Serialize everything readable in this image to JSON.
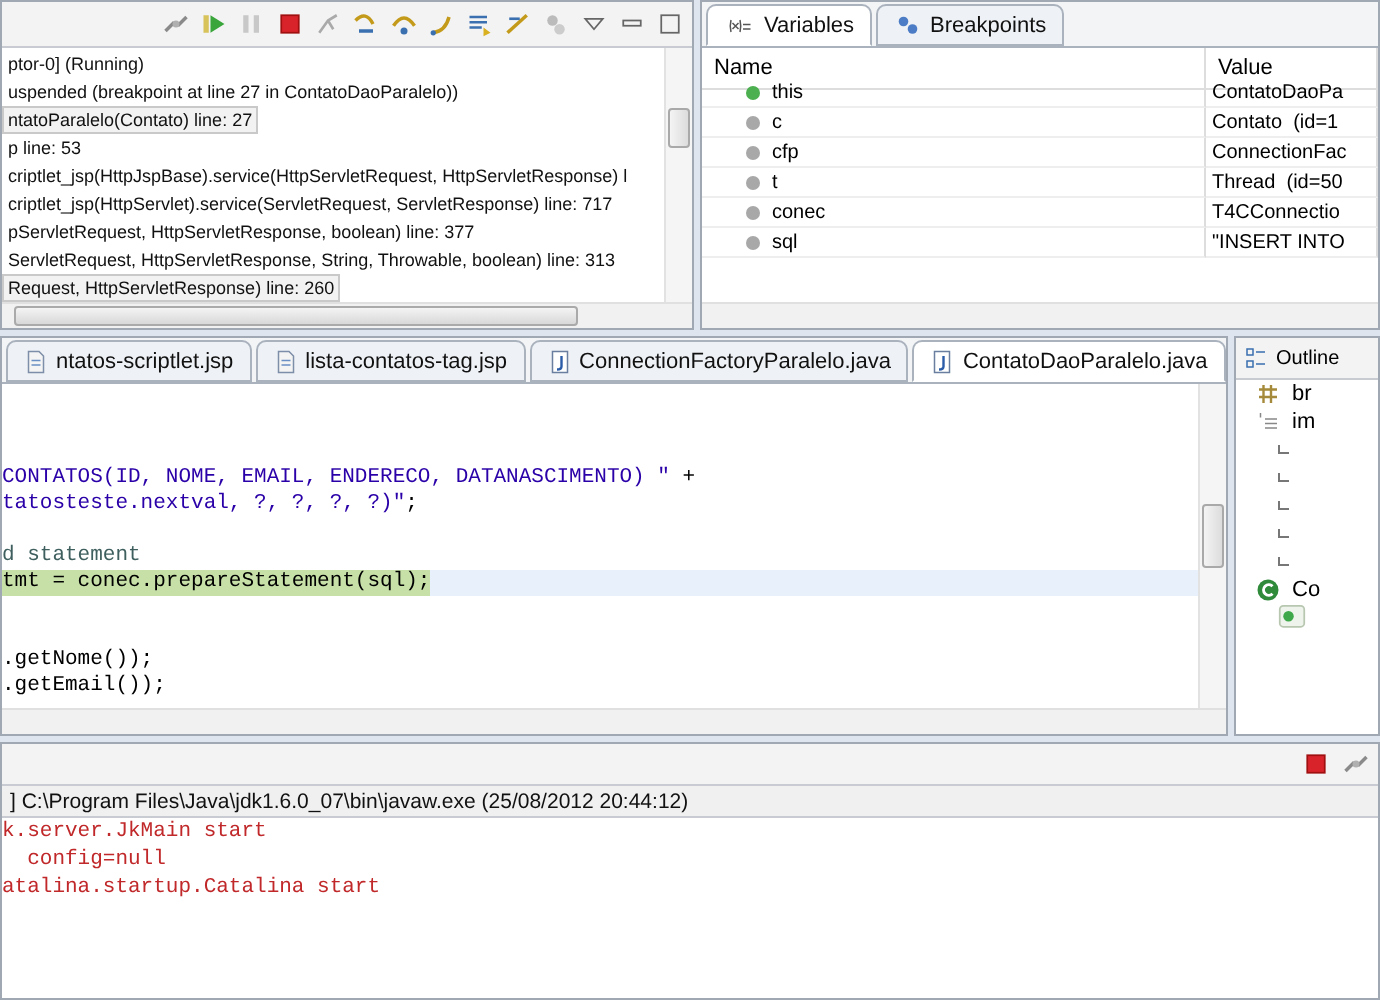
{
  "debug": {
    "frames": [
      {
        "text": "ptor-0] (Running)",
        "selected": false
      },
      {
        "text": "uspended (breakpoint at line 27 in ContatoDaoParalelo))",
        "selected": false
      },
      {
        "text": "ntatoParalelo(Contato) line: 27",
        "selected": true
      },
      {
        "text": "p line: 53",
        "selected": false
      },
      {
        "text": "criptlet_jsp(HttpJspBase).service(HttpServletRequest, HttpServletResponse) l",
        "selected": false
      },
      {
        "text": "criptlet_jsp(HttpServlet).service(ServletRequest, ServletResponse) line: 717",
        "selected": false
      },
      {
        "text": "pServletRequest, HttpServletResponse, boolean) line: 377",
        "selected": false
      },
      {
        "text": "ServletRequest, HttpServletResponse, String, Throwable, boolean) line: 313",
        "selected": false
      },
      {
        "text": "Request, HttpServletResponse) line: 260",
        "selected": true
      }
    ]
  },
  "variables": {
    "tabs": [
      {
        "label": "Variables",
        "kind": "variables",
        "selected": true
      },
      {
        "label": "Breakpoints",
        "kind": "breakpoints",
        "selected": false
      }
    ],
    "columns": [
      "Name",
      "Value"
    ],
    "rows": [
      {
        "name": "this",
        "value": "ContatoDaoPa",
        "color": "#4caf50"
      },
      {
        "name": "c",
        "value": "Contato  (id=1",
        "color": "#a8a8a8"
      },
      {
        "name": "cfp",
        "value": "ConnectionFac",
        "color": "#a8a8a8"
      },
      {
        "name": "t",
        "value": "Thread  (id=50",
        "color": "#a8a8a8"
      },
      {
        "name": "conec",
        "value": "T4CConnectio",
        "color": "#a8a8a8"
      },
      {
        "name": "sql",
        "value": "\"INSERT INTO",
        "color": "#a8a8a8"
      }
    ]
  },
  "editor": {
    "tabs": [
      {
        "label": "ntatos-scriptlet.jsp",
        "kind": "jsp",
        "selected": false
      },
      {
        "label": "lista-contatos-tag.jsp",
        "kind": "jsp",
        "selected": false
      },
      {
        "label": "ConnectionFactoryParalelo.java",
        "kind": "java",
        "selected": false
      },
      {
        "label": "ContatoDaoParalelo.java",
        "kind": "java",
        "selected": true
      }
    ],
    "lines": [
      {
        "current": false
      },
      {
        "current": false
      },
      {
        "current": false
      },
      {
        "current": false,
        "segments": [
          {
            "kind": "string",
            "text": "CONTATOS(ID, NOME, EMAIL, ENDERECO, DATANASCIMENTO) \""
          },
          {
            "kind": "plain",
            "text": " +"
          }
        ]
      },
      {
        "current": false,
        "segments": [
          {
            "kind": "string",
            "text": "tatosteste.nextval, ?, ?, ?, ?)\""
          },
          {
            "kind": "plain",
            "text": ";"
          }
        ]
      },
      {
        "current": false
      },
      {
        "current": false,
        "segments": [
          {
            "kind": "comment",
            "text": "d statement"
          }
        ]
      },
      {
        "current": true,
        "segments": [
          {
            "kind": "plain",
            "text": "tmt = conec.prepareStatement(sql);"
          }
        ]
      },
      {
        "current": false
      },
      {
        "current": false
      },
      {
        "current": false,
        "segments": [
          {
            "kind": "plain",
            "text": ".getNome());"
          }
        ]
      },
      {
        "current": false,
        "segments": [
          {
            "kind": "plain",
            "text": ".getEmail());"
          }
        ]
      }
    ]
  },
  "outline": {
    "title": "Outline",
    "items": [
      {
        "kind": "package",
        "label": "br"
      },
      {
        "kind": "imports",
        "label": "im",
        "children": [
          {
            "kind": "import"
          },
          {
            "kind": "import"
          },
          {
            "kind": "import"
          },
          {
            "kind": "import"
          },
          {
            "kind": "import"
          }
        ]
      },
      {
        "kind": "class",
        "label": "Co",
        "children": [
          {
            "kind": "method"
          }
        ]
      }
    ]
  },
  "console": {
    "title": "] C:\\Program Files\\Java\\jdk1.6.0_07\\bin\\javaw.exe (25/08/2012 20:44:12)",
    "lines": [
      "k.server.JkMain start",
      "  config=null",
      "atalina.startup.Catalina start"
    ]
  }
}
